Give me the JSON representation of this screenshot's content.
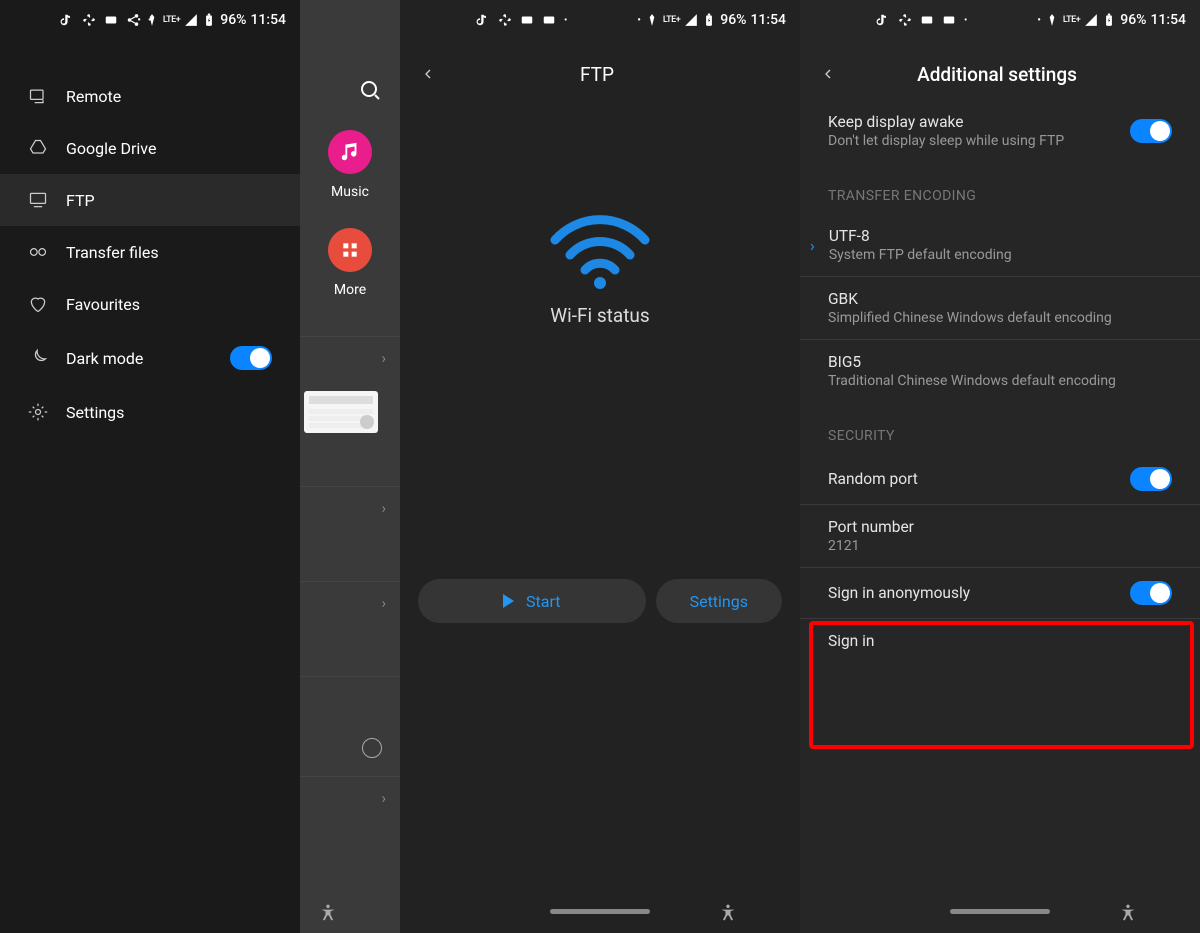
{
  "status": {
    "battery": "96%",
    "time": "11:54",
    "lte": "LTE+"
  },
  "screen1": {
    "drawer": {
      "items": [
        {
          "label": "Remote"
        },
        {
          "label": "Google Drive"
        },
        {
          "label": "FTP"
        },
        {
          "label": "Transfer files"
        },
        {
          "label": "Favourites"
        },
        {
          "label": "Dark mode"
        },
        {
          "label": "Settings"
        }
      ],
      "dark_mode_on": true,
      "selected_index": 2
    },
    "partial": {
      "grid": [
        {
          "label": "Music"
        },
        {
          "label": "More"
        }
      ]
    }
  },
  "screen2": {
    "title": "FTP",
    "wifi_label": "Wi-Fi status",
    "start_label": "Start",
    "settings_label": "Settings"
  },
  "screen3": {
    "title": "Additional settings",
    "items": {
      "keep_awake": {
        "title": "Keep display awake",
        "sub": "Don't let display sleep while using FTP",
        "on": true
      },
      "section_encoding": "TRANSFER ENCODING",
      "utf8": {
        "title": "UTF-8",
        "sub": "System FTP default encoding",
        "selected": true
      },
      "gbk": {
        "title": "GBK",
        "sub": "Simplified Chinese Windows default encoding"
      },
      "big5": {
        "title": "BIG5",
        "sub": "Traditional Chinese Windows default encoding"
      },
      "section_security": "SECURITY",
      "random_port": {
        "title": "Random port",
        "on": true
      },
      "port_number": {
        "title": "Port number",
        "sub": "2121"
      },
      "sign_anon": {
        "title": "Sign in anonymously",
        "on": true
      },
      "sign_in": {
        "title": "Sign in"
      }
    }
  }
}
